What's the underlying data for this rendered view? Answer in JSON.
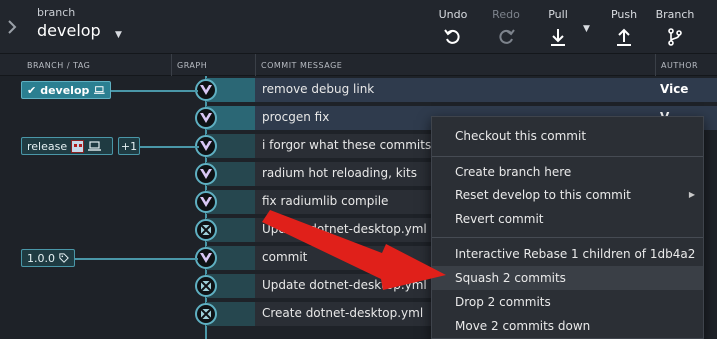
{
  "toolbar": {
    "branch_caption": "branch",
    "branch_name": "develop",
    "buttons": {
      "undo": "Undo",
      "redo": "Redo",
      "pull": "Pull",
      "push": "Push",
      "branch": "Branch"
    }
  },
  "columns": {
    "branch_tag": "BRANCH / TAG",
    "graph": "GRAPH",
    "message": "COMMIT MESSAGE",
    "author": "AUTHOR"
  },
  "tags": {
    "develop": "develop",
    "release": "release",
    "plus_count": "+1",
    "version": "1.0.0"
  },
  "commits": [
    {
      "message": "remove debug link",
      "author": "Vice"
    },
    {
      "message": "procgen fix",
      "author": "V"
    },
    {
      "message": "i forgor what these commits do",
      "author": ""
    },
    {
      "message": "radium hot reloading, kits",
      "author": ""
    },
    {
      "message": "fix radiumlib compile",
      "author": ""
    },
    {
      "message": "Update dotnet-desktop.yml",
      "author": ""
    },
    {
      "message": "commit",
      "author": ""
    },
    {
      "message": "Update dotnet-desktop.yml",
      "author": ""
    },
    {
      "message": "Create dotnet-desktop.yml",
      "author": ""
    }
  ],
  "context_menu": {
    "checkout": "Checkout this commit",
    "create_branch": "Create branch here",
    "reset": "Reset develop to this commit",
    "revert": "Revert commit",
    "interactive_rebase": "Interactive Rebase 1 children of 1db4a2",
    "squash": "Squash 2 commits",
    "drop": "Drop 2 commits",
    "move_down": "Move 2 commits down"
  },
  "colors": {
    "accent": "#4a97a8",
    "annotation_arrow": "#e0201a"
  }
}
